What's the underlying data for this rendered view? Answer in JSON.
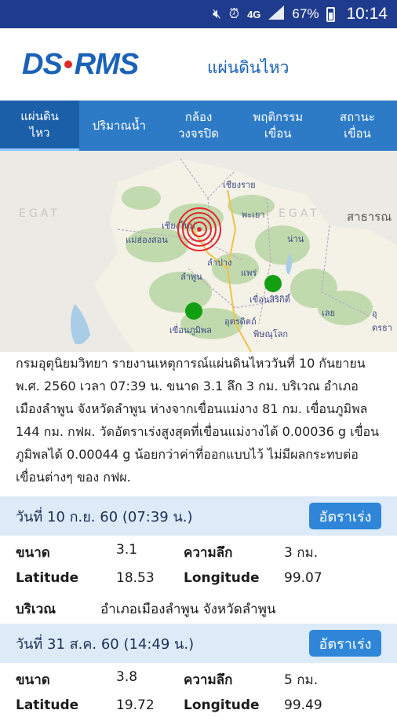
{
  "status_bar": {
    "icons": [
      "mute-icon",
      "alarm-icon",
      "4g-icon",
      "signal-icon",
      "battery-icon"
    ],
    "network": "4G",
    "battery_percent": "67%",
    "time": "10:14"
  },
  "header": {
    "logo_left": "DS",
    "logo_right": "RMS",
    "title": "แผ่นดินไหว"
  },
  "tabs": [
    {
      "label": "แผ่นดิน\nไหว",
      "active": true
    },
    {
      "label": "ปริมาณน้ำ",
      "active": false
    },
    {
      "label": "กล้อง\nวงจรปิด",
      "active": false
    },
    {
      "label": "พฤติกรรม\nเขื่อน",
      "active": false
    },
    {
      "label": "สถานะ\nเขื่อน",
      "active": false
    }
  ],
  "map": {
    "watermarks": [
      "EGAT",
      "EGAT"
    ],
    "labels": {
      "chiang_rai": "เชียงราย",
      "phayao": "พะเยา",
      "chiang_mai": "เชียงใหม่",
      "mae_hong_son": "แม่ฮ่องสอน",
      "nan": "น่าน",
      "lampang": "ลำปาง",
      "lamphun": "ลำพูน",
      "phrae": "แพร่",
      "sirikit": "เขื่อนสิริกิติ์",
      "bhumibol": "เขื่อนภูมิพล",
      "uttaradit": "อุตรดิตถ์",
      "phitsanulok": "พิษณุโลก",
      "loei": "เลย",
      "udon": "อุดรธา",
      "sakhon": "สาธารณ"
    },
    "colors": {
      "epicenter": "#e3262e",
      "dam_marker": "#12a012",
      "mountain": "#b8d4a4"
    }
  },
  "description": "กรมอุตุนิยมวิทยา รายงานเหตุการณ์แผ่นดินไหววันที่ 10 กันยายน พ.ศ. 2560 เวลา 07:39 น. ขนาด 3.1 ลึก 3 กม. บริเวณ อำเภอเมืองลำพูน จังหวัดลำพูน ห่างจากเขื่อนแม่งาง 81 กม. เขื่อนภูมิพล 144 กม. กฟผ. วัดอัตราเร่งสูงสุดที่เขื่อนแม่งางได้ 0.00036 g เขื่อนภูมิพลได้ 0.00044 g น้อยกว่าค่าที่ออกแบบไว้ ไม่มีผลกระทบต่อเขื่อนต่างๆ ของ กฟผ.",
  "events": [
    {
      "date": "วันที่ 10 ก.ย. 60 (07:39 น.)",
      "button": "อัตราเร่ง",
      "magnitude_label": "ขนาด",
      "magnitude": "3.1",
      "depth_label": "ความลึก",
      "depth": "3 กม.",
      "lat_label": "Latitude",
      "lat": "18.53",
      "lon_label": "Longitude",
      "lon": "99.07",
      "area_label": "บริเวณ",
      "area": "อำเภอเมืองลำพูน จังหวัดลำพูน"
    },
    {
      "date": "วันที่ 31 ส.ค. 60 (14:49 น.)",
      "button": "อัตราเร่ง",
      "magnitude_label": "ขนาด",
      "magnitude": "3.8",
      "depth_label": "ความลึก",
      "depth": "5 กม.",
      "lat_label": "Latitude",
      "lat": "19.72",
      "lon_label": "Longitude",
      "lon": "99.49"
    }
  ]
}
